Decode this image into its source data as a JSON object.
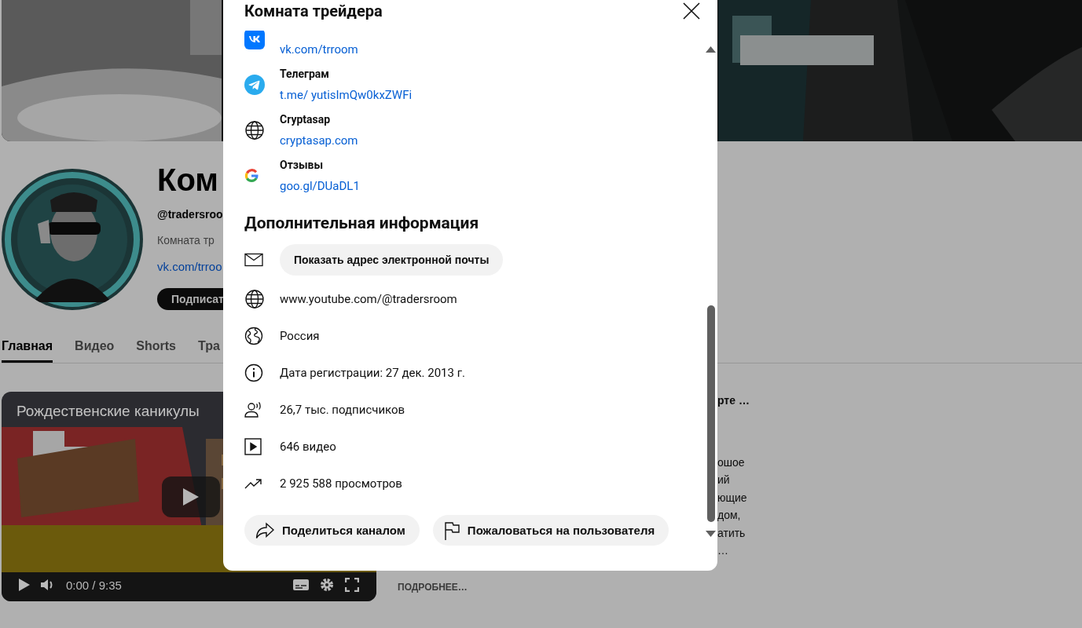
{
  "channel": {
    "title": "Ком",
    "handle": "@tradersroo",
    "description": "Комната тр",
    "link": "vk.com/trroo",
    "subscribe_button": "Подписат"
  },
  "tabs": [
    {
      "label": "Главная",
      "selected": true
    },
    {
      "label": "Видео",
      "selected": false
    },
    {
      "label": "Shorts",
      "selected": false
    },
    {
      "label": "Тра",
      "selected": false
    }
  ],
  "featured_video": {
    "title": "Рождественские каникулы",
    "time": "0:00 / 9:35"
  },
  "video_details": {
    "title": "рте …",
    "lines": [
      "ошое",
      "ий",
      "ющие",
      "дом,",
      "атить",
      "…"
    ],
    "more": "ПОДРОБНЕЕ…"
  },
  "dialog": {
    "title": "Комната трейдера",
    "links": [
      {
        "kind": "vk",
        "url": "vk.com/trroom"
      },
      {
        "kind": "telegram",
        "title": "Телеграм",
        "url": "t.me/ yutisImQw0kxZWFi"
      },
      {
        "kind": "website",
        "title": "Cryptasap",
        "url": "cryptasap.com"
      },
      {
        "kind": "google",
        "title": "Отзывы",
        "url": "goo.gl/DUaDL1"
      }
    ],
    "details_heading": "Дополнительная информация",
    "email_button": "Показать адрес электронной почты",
    "details": [
      {
        "kind": "link",
        "text": "www.youtube.com/@tradersroom"
      },
      {
        "kind": "country",
        "text": "Россия"
      },
      {
        "kind": "joined",
        "text": "Дата регистрации: 27 дек. 2013 г."
      },
      {
        "kind": "subscribers",
        "text": "26,7 тыс. подписчиков"
      },
      {
        "kind": "videos",
        "text": "646 видео"
      },
      {
        "kind": "views",
        "text": "2 925 588 просмотров"
      }
    ],
    "actions": [
      {
        "kind": "share",
        "label": "Поделиться каналом"
      },
      {
        "kind": "report",
        "label": "Пожаловаться на пользователя"
      }
    ]
  }
}
